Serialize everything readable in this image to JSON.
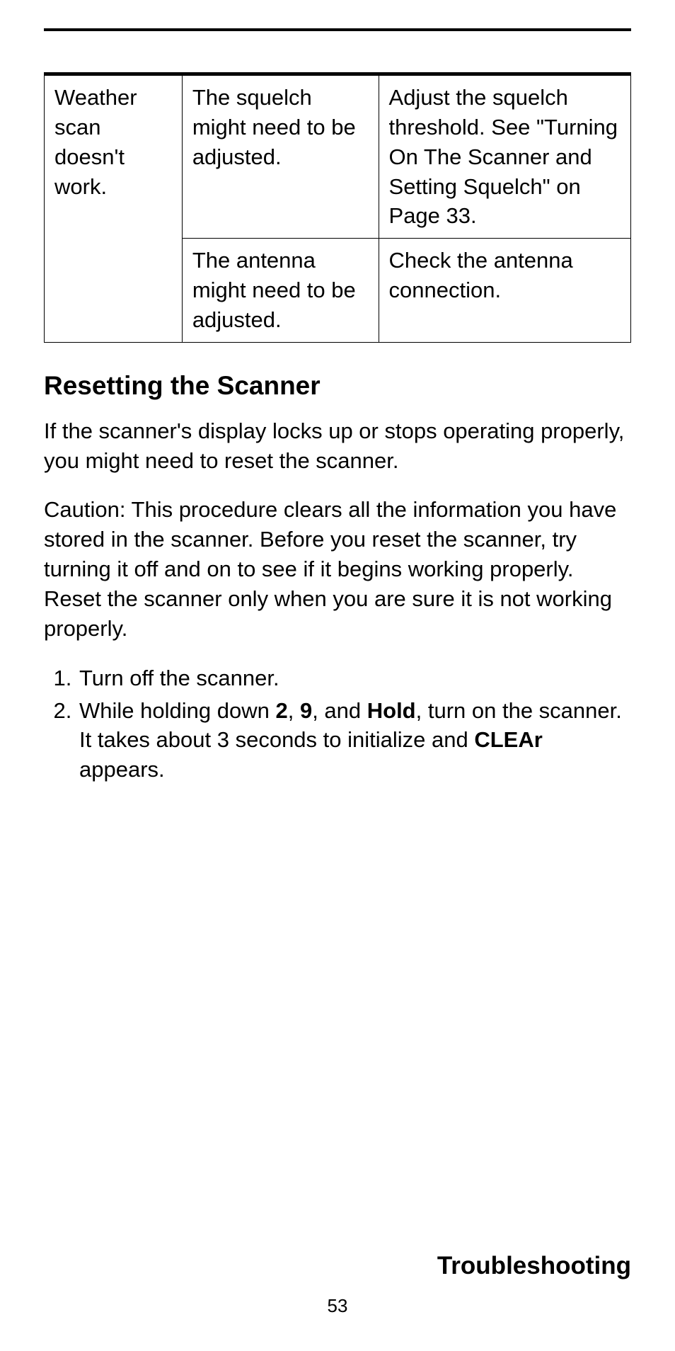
{
  "table": {
    "problem": "Weather scan doesn't work.",
    "rows": [
      {
        "cause": "The squelch might need to be adjusted.",
        "solution": "Adjust the squelch threshold. See \"Turning On The Scanner and Setting Squelch\" on Page 33."
      },
      {
        "cause": "The antenna might need to be adjusted.",
        "solution": "Check the antenna connection."
      }
    ]
  },
  "section_heading": "Resetting the Scanner",
  "para1": "If the scanner's display locks up or stops operating properly, you might need to reset the scanner.",
  "para2": "Caution: This procedure clears all the information you have stored in the scanner. Before you reset the scanner, try turning it off and on to see if it begins working properly. Reset the scanner only when you are sure it is not working properly.",
  "steps": {
    "s1": "Turn off the scanner.",
    "s2_a": "While holding down ",
    "s2_key1": "2",
    "s2_b": ", ",
    "s2_key2": "9",
    "s2_c": ", and ",
    "s2_key3": "Hold",
    "s2_d": ", turn on the scanner. It takes about 3 seconds to initialize and ",
    "s2_key4": "CLEAr",
    "s2_e": " appears."
  },
  "footer_title": "Troubleshooting",
  "page_number": "53"
}
